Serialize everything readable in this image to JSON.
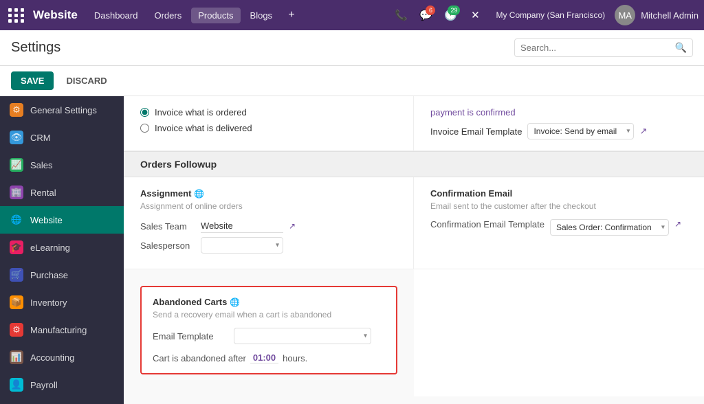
{
  "topnav": {
    "brand": "Website",
    "links": [
      "Dashboard",
      "Orders",
      "Products",
      "Blogs"
    ],
    "plus_label": "+",
    "company": "My Company (San Francisco)",
    "user": "Mitchell Admin",
    "badge_messages": "6",
    "badge_activity": "29"
  },
  "page": {
    "title": "Settings",
    "search_placeholder": "Search..."
  },
  "actions": {
    "save_label": "SAVE",
    "discard_label": "DISCARD"
  },
  "sidebar": {
    "items": [
      {
        "label": "General Settings",
        "icon": "⚙",
        "color": "orange",
        "active": false
      },
      {
        "label": "CRM",
        "icon": "👁",
        "color": "blue",
        "active": false
      },
      {
        "label": "Sales",
        "icon": "📈",
        "color": "green",
        "active": false
      },
      {
        "label": "Rental",
        "icon": "🏢",
        "color": "purple",
        "active": false
      },
      {
        "label": "Website",
        "icon": "🌐",
        "color": "teal",
        "active": true
      },
      {
        "label": "eLearning",
        "icon": "🎓",
        "color": "pink",
        "active": false
      },
      {
        "label": "Purchase",
        "icon": "🛒",
        "color": "indigo",
        "active": false
      },
      {
        "label": "Inventory",
        "icon": "📦",
        "color": "amber",
        "active": false
      },
      {
        "label": "Manufacturing",
        "icon": "⚙",
        "color": "red",
        "active": false
      },
      {
        "label": "Accounting",
        "icon": "📊",
        "color": "brown",
        "active": false
      },
      {
        "label": "Payroll",
        "icon": "👤",
        "color": "cyan",
        "active": false
      }
    ]
  },
  "main": {
    "invoice_section": {
      "radio1": "Invoice what is ordered",
      "radio2": "Invoice what is delivered",
      "payment_text": "payment is confirmed",
      "invoice_email_label": "Invoice Email Template",
      "invoice_email_value": "Invoice: Send by email"
    },
    "orders_followup": {
      "section_title": "Orders Followup",
      "assignment": {
        "title": "Assignment",
        "subtitle": "Assignment of online orders",
        "sales_team_label": "Sales Team",
        "sales_team_value": "Website",
        "salesperson_label": "Salesperson"
      },
      "confirmation": {
        "title": "Confirmation Email",
        "subtitle": "Email sent to the customer after the checkout",
        "label": "Confirmation Email Template",
        "value": "Sales Order: Confirmation"
      },
      "abandoned_carts": {
        "title": "Abandoned Carts",
        "subtitle": "Send a recovery email when a cart is abandoned",
        "email_template_label": "Email Template",
        "cart_abandoned_prefix": "Cart is abandoned after",
        "cart_time": "01:00",
        "cart_abandoned_suffix": "hours."
      }
    }
  }
}
